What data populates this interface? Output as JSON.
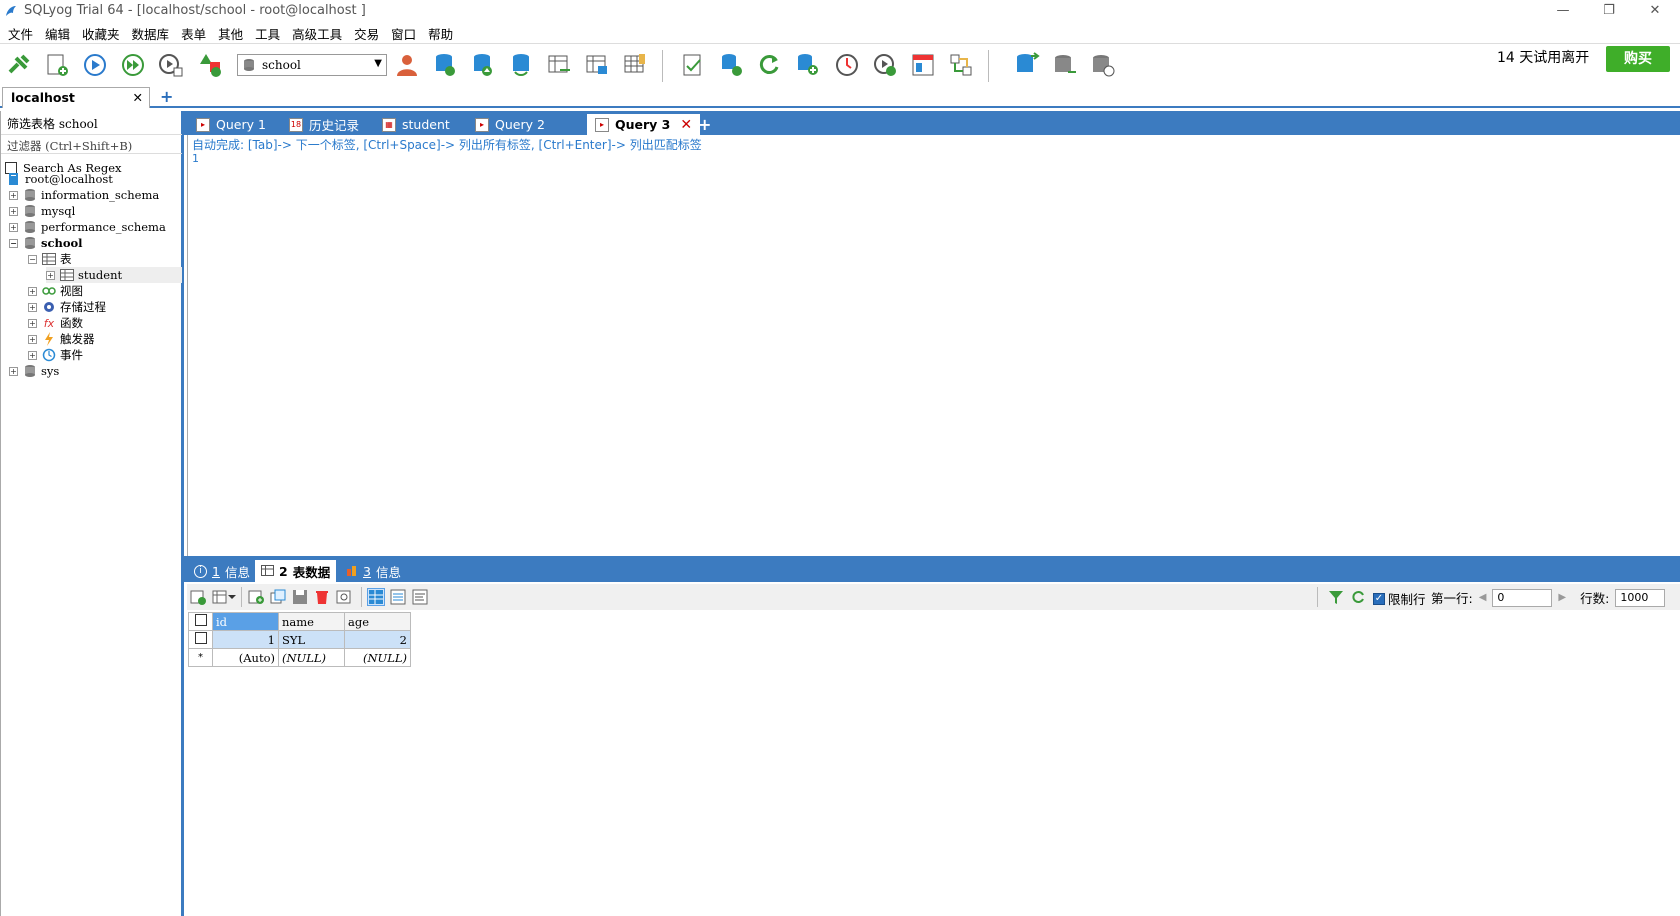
{
  "window": {
    "title": "SQLyog Trial 64 - [localhost/school - root@localhost ]",
    "minimize": "—",
    "restore": "❐",
    "close": "✕"
  },
  "menubar": [
    "文件",
    "编辑",
    "收藏夹",
    "数据库",
    "表单",
    "其他",
    "工具",
    "高级工具",
    "交易",
    "窗口",
    "帮助"
  ],
  "toolbar": {
    "database_select": "school",
    "trial_text": "14 天试用离开",
    "buy_label": "购买"
  },
  "connection_tab": {
    "label": "localhost",
    "close": "✕",
    "add": "+"
  },
  "object_browser": {
    "filter_label": "筛选表格",
    "filter_value": "school",
    "filter_placeholder": "过滤器 (Ctrl+Shift+B)",
    "regex_label": "Search As Regex",
    "root": "root@localhost",
    "databases": [
      "information_schema",
      "mysql",
      "performance_schema",
      "school",
      "sys"
    ],
    "school_children": {
      "tables": "表",
      "table_items": [
        "student"
      ],
      "views": "视图",
      "procedures": "存储过程",
      "functions": "函数",
      "triggers": "触发器",
      "events": "事件"
    }
  },
  "query_tabs": [
    {
      "label": "Query 1"
    },
    {
      "label": "历史记录"
    },
    {
      "label": "student"
    },
    {
      "label": "Query 2"
    },
    {
      "label": "Query 3",
      "active": true
    }
  ],
  "query_tab_close": "✕",
  "query_tab_add": "+",
  "editor": {
    "autocomplete_hint": "自动完成: [Tab]-> 下一个标签, [Ctrl+Space]-> 列出所有标签, [Ctrl+Enter]-> 列出匹配标签",
    "line_number": "1"
  },
  "result_tabs": [
    {
      "num": "1",
      "label": "信息"
    },
    {
      "num": "2",
      "label": "表数据",
      "active": true
    },
    {
      "num": "3",
      "label": "信息"
    }
  ],
  "result_toolbar": {
    "limit_label": "限制行",
    "first_row_label": "第一行:",
    "first_row_value": "0",
    "rows_label": "行数:",
    "rows_value": "1000"
  },
  "grid": {
    "columns": [
      "id",
      "name",
      "age"
    ],
    "rows": [
      {
        "marker": "",
        "cells": [
          "1",
          "SYL",
          "2"
        ]
      },
      {
        "marker": "*",
        "cells": [
          "(Auto)",
          "(NULL)",
          "(NULL)"
        ]
      }
    ]
  },
  "colors": {
    "accent": "#3c7bc0",
    "buy": "#3fae29"
  }
}
